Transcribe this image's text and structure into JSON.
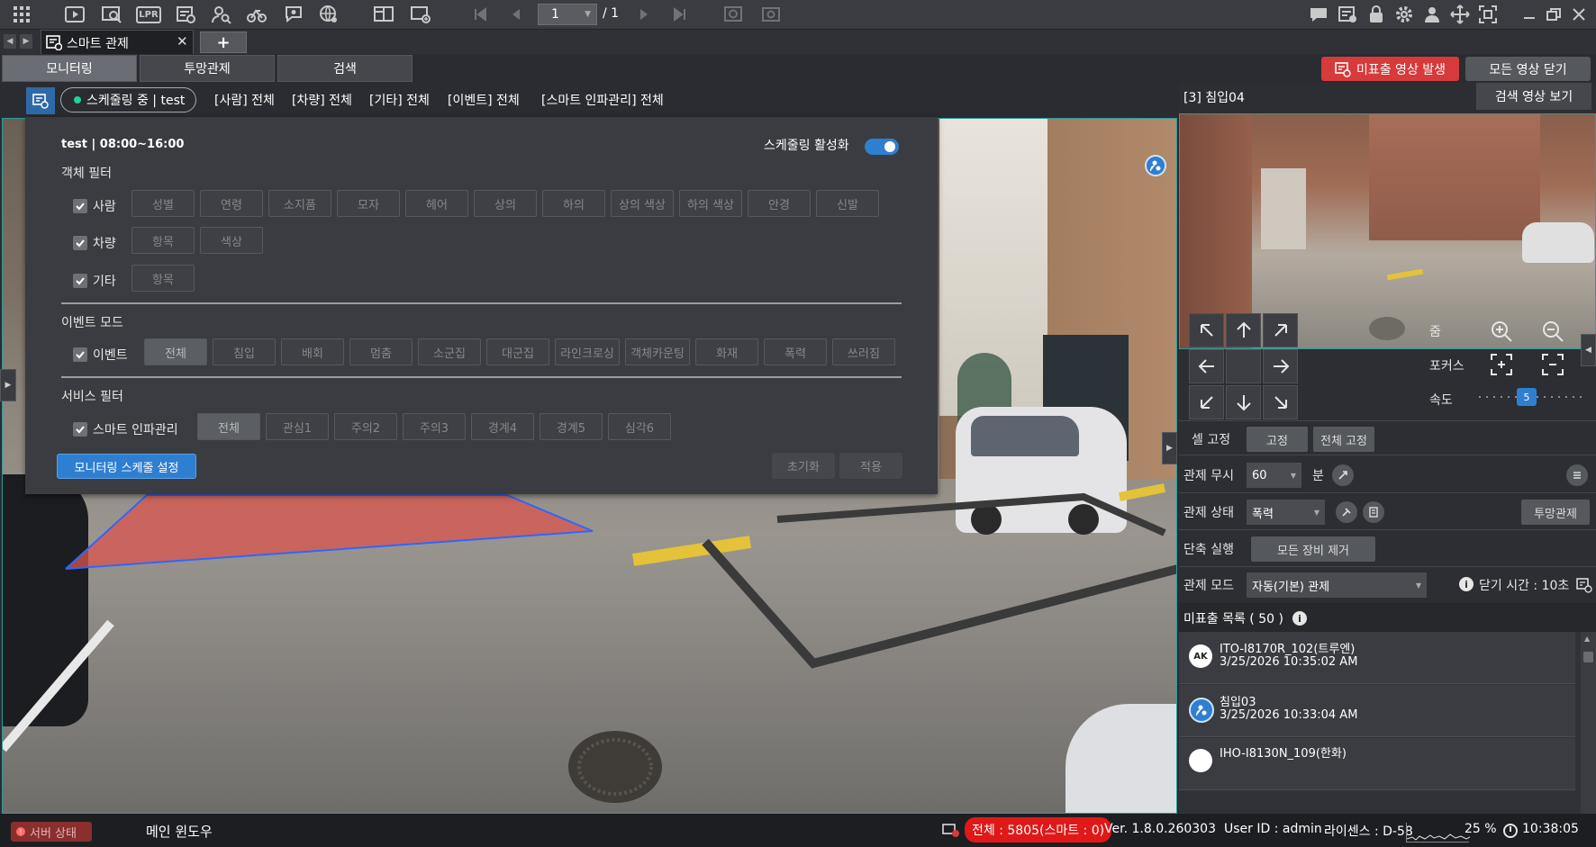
{
  "toolbar": {
    "page_current": "1",
    "page_total": "/ 1",
    "lpr_label": "LPR"
  },
  "tabs": {
    "active_label": "스마트 관제",
    "add_label": "+"
  },
  "subtabs": [
    "모니터링",
    "투망관제",
    "검색"
  ],
  "header": {
    "alert_button": "미표출 영상 발생",
    "close_all_button": "모든 영상 닫기"
  },
  "filterbar": {
    "schedule_pill": "스케줄링 중 | test",
    "chips": [
      "[사람] 전체",
      "[차량] 전체",
      "[기타] 전체",
      "[이벤트] 전체",
      "[스마트 인파관리] 전체"
    ]
  },
  "panel": {
    "schedule_title": "test | 08:00~16:00",
    "schedule_toggle_label": "스케줄링 활성화",
    "object_filter_title": "객체 필터",
    "person_label": "사람",
    "person_buttons": [
      "성별",
      "연령",
      "소지품",
      "모자",
      "헤어",
      "상의",
      "하의",
      "상의 색상",
      "하의 색상",
      "안경",
      "신발"
    ],
    "vehicle_label": "차량",
    "vehicle_buttons": [
      "항목",
      "색상"
    ],
    "other_label": "기타",
    "other_buttons": [
      "항목"
    ],
    "event_mode_title": "이벤트 모드",
    "event_label": "이벤트",
    "event_buttons": [
      "전체",
      "침입",
      "배회",
      "멈춤",
      "소군집",
      "대군집",
      "라인크로싱",
      "객체카운팅",
      "화재",
      "폭력",
      "쓰러짐"
    ],
    "service_filter_title": "서비스 필터",
    "smart_label": "스마트 인파관리",
    "smart_buttons": [
      "전체",
      "관심1",
      "주의2",
      "주의3",
      "경계4",
      "경계5",
      "심각6"
    ],
    "schedule_button": "모니터링 스케줄 설정",
    "reset_button": "초기화",
    "apply_button": "적용"
  },
  "right": {
    "camera_title": "[3] 침입04",
    "search_video_button": "검색 영상 보기",
    "zoom_label": "줌",
    "focus_label": "포커스",
    "speed_label": "속도",
    "speed_value": "5",
    "speed_level": 0.45,
    "cell_fix_label": "셀 고정",
    "fix_button": "고정",
    "fix_all_button": "전체 고정",
    "ignore_label": "관제 무시",
    "ignore_value": "60",
    "ignore_unit": "분",
    "status_label": "관제 상태",
    "status_value": "폭력",
    "patrol_button": "투망관제",
    "shortcut_label": "단축 실행",
    "remove_all_button": "모든 장비 제거",
    "mode_label": "관제 모드",
    "mode_value": "자동(기본) 관제",
    "close_time": "닫기 시간 : 10초",
    "unshown_list_title": "미표출 목록 ( 50 )",
    "list": [
      {
        "name": "ITO-I8170R_102(트루엔)",
        "time": "3/25/2026 10:35:02 AM"
      },
      {
        "name": "침입03",
        "time": "3/25/2026 10:33:04 AM"
      },
      {
        "name": "IHO-I8130N_109(한화)",
        "time": ""
      }
    ]
  },
  "status": {
    "server_status": "서버 상태",
    "main_window": "메인 윈도우",
    "total": "전체 : 5805(스마트 : 0)",
    "version": "Ver. 1.8.0.260303",
    "user": "User ID : admin",
    "license": "라이센스 : D-58",
    "cpu": "25 %",
    "clock": "10:38:05"
  },
  "colors": {
    "accent_blue": "#2f7fd1",
    "alert_red": "#d63a3a",
    "teal_border": "#2a9c9c",
    "status_green": "#23d19a"
  }
}
